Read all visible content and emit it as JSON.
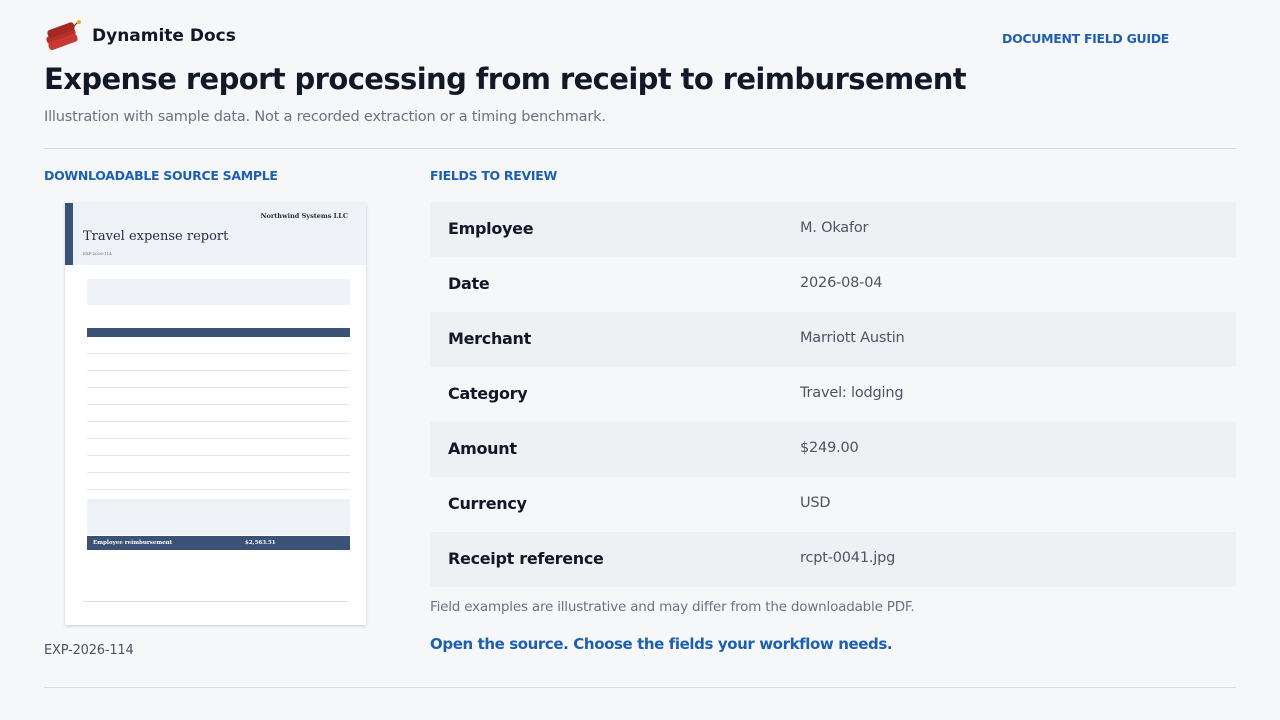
{
  "header": {
    "brand_name": "Dynamite Docs",
    "logo_icon": "dynamite-icon",
    "guide_link": "DOCUMENT FIELD GUIDE"
  },
  "page": {
    "title": "Expense report processing from receipt to reimbursement",
    "subtitle": "Illustration with sample data. Not a recorded extraction or a timing benchmark."
  },
  "source": {
    "section_label": "DOWNLOADABLE SOURCE SAMPLE",
    "document_id": "EXP-2026-114",
    "thumbnail": {
      "company": "Northwind Systems LLC",
      "title": "Travel expense report",
      "code": "EXP-2026-114",
      "reimbursement_label": "Employee reimbursement",
      "reimbursement_value": "$2,563.51"
    }
  },
  "fields": {
    "section_label": "FIELDS TO REVIEW",
    "rows": [
      {
        "label": "Employee",
        "value": "M. Okafor"
      },
      {
        "label": "Date",
        "value": "2026-08-04"
      },
      {
        "label": "Merchant",
        "value": "Marriott Austin"
      },
      {
        "label": "Category",
        "value": "Travel: lodging"
      },
      {
        "label": "Amount",
        "value": "$249.00"
      },
      {
        "label": "Currency",
        "value": "USD"
      },
      {
        "label": "Receipt reference",
        "value": "rcpt-0041.jpg"
      }
    ],
    "note": "Field examples are illustrative and may differ from the downloadable PDF.",
    "cta": "Open the source. Choose the fields your workflow needs."
  },
  "colors": {
    "accent": "#1e5fb0",
    "title": "#111827",
    "row_shade": "#eef1f4",
    "doc_navy": "#3a5275"
  }
}
